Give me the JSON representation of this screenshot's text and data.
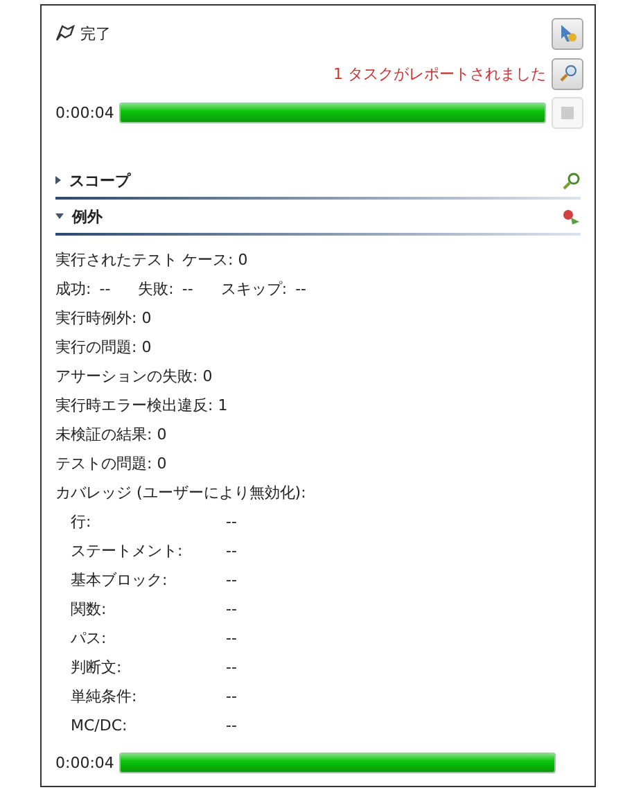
{
  "status": {
    "label": "完了"
  },
  "report_message": "1 タスクがレポートされました",
  "progress": {
    "elapsed": "0:00:04",
    "level": 1,
    "stop_disabled": true
  },
  "sections": [
    {
      "title": "スコープ",
      "expanded": false
    },
    {
      "title": "例外",
      "expanded": true
    }
  ],
  "stats": [
    "実行されたテスト ケース: 0",
    "実行時例外: 0",
    "実行の問題: 0",
    "アサーションの失敗: 0",
    "実行時エラー検出違反: 1",
    "未検証の結果: 0",
    "テストの問題: 0"
  ],
  "results": [
    {
      "label": "成功:",
      "value": "--"
    },
    {
      "label": "失敗:",
      "value": "--"
    },
    {
      "label": "スキップ:",
      "value": "--"
    }
  ],
  "coverage": {
    "title": "カバレッジ (ユーザーにより無効化):",
    "rows": [
      {
        "label": "行:",
        "value": "--"
      },
      {
        "label": "ステートメント:",
        "value": "--"
      },
      {
        "label": "基本ブロック:",
        "value": "--"
      },
      {
        "label": "関数:",
        "value": "--"
      },
      {
        "label": "パス:",
        "value": "--"
      },
      {
        "label": "判断文:",
        "value": "--"
      },
      {
        "label": "単純条件:",
        "value": "--"
      },
      {
        "label": "MC/DC:",
        "value": "--"
      }
    ]
  },
  "bottom_progress": {
    "elapsed": "0:00:04",
    "level": 1
  }
}
